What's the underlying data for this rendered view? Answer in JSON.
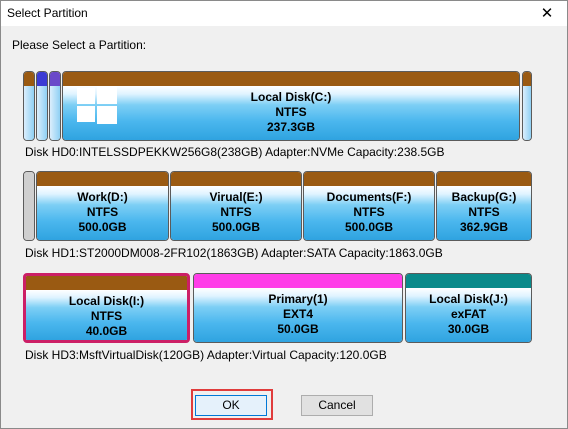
{
  "window": {
    "title": "Select Partition"
  },
  "prompt": "Please Select a Partition:",
  "disks": [
    {
      "info": "Disk HD0:INTELSSDPEKKW256G8(238GB)  Adapter:NVMe  Capacity:238.5GB",
      "partitions": [
        {
          "name": "Local Disk(C:)",
          "fs": "NTFS",
          "size": "237.3GB"
        }
      ]
    },
    {
      "info": "Disk HD1:ST2000DM008-2FR102(1863GB)  Adapter:SATA  Capacity:1863.0GB",
      "partitions": [
        {
          "name": "Work(D:)",
          "fs": "NTFS",
          "size": "500.0GB"
        },
        {
          "name": "Virual(E:)",
          "fs": "NTFS",
          "size": "500.0GB"
        },
        {
          "name": "Documents(F:)",
          "fs": "NTFS",
          "size": "500.0GB"
        },
        {
          "name": "Backup(G:)",
          "fs": "NTFS",
          "size": "362.9GB"
        }
      ]
    },
    {
      "info": "Disk HD3:MsftVirtualDisk(120GB)  Adapter:Virtual  Capacity:120.0GB",
      "partitions": [
        {
          "name": "Local Disk(I:)",
          "fs": "NTFS",
          "size": "40.0GB"
        },
        {
          "name": "Primary(1)",
          "fs": "EXT4",
          "size": "50.0GB"
        },
        {
          "name": "Local Disk(J:)",
          "fs": "exFAT",
          "size": "30.0GB"
        }
      ]
    }
  ],
  "colors": {
    "ntfs_header": "#9a5a12",
    "ext4_header": "#ff3de8",
    "exfat_header": "#0a8a8a",
    "selected_border": "#cc1f66",
    "small_part_blue": "#3b3bd4",
    "small_part_purple": "#6a49c9"
  },
  "buttons": {
    "ok": "OK",
    "cancel": "Cancel"
  }
}
